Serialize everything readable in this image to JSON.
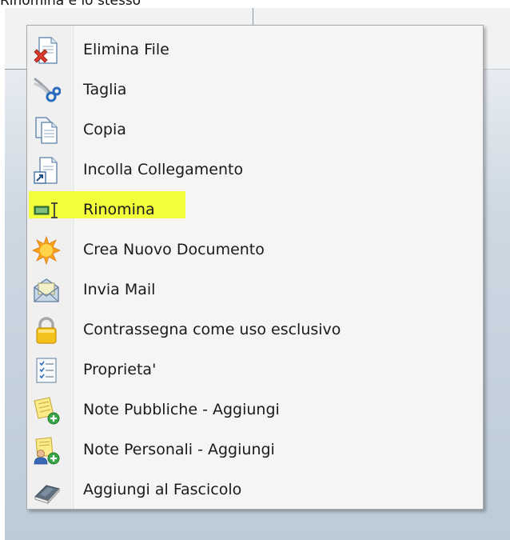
{
  "caption": "Rinomina e lo stesso",
  "colors": {
    "highlight": "#f2ff3b",
    "menu_background": "#f5f5f5",
    "menu_border": "#a8a8a8"
  },
  "menu": {
    "items": [
      {
        "label": "Elimina File",
        "icon": "delete-file-icon"
      },
      {
        "label": "Taglia",
        "icon": "scissors-icon"
      },
      {
        "label": "Copia",
        "icon": "copy-icon"
      },
      {
        "label": "Incolla Collegamento",
        "icon": "paste-link-icon"
      },
      {
        "label": "Rinomina",
        "icon": "rename-icon",
        "highlighted": true
      },
      {
        "label": "Crea Nuovo Documento",
        "icon": "new-document-star-icon"
      },
      {
        "label": "Invia Mail",
        "icon": "mail-icon"
      },
      {
        "label": "Contrassegna come uso esclusivo",
        "icon": "lock-icon"
      },
      {
        "label": "Proprieta'",
        "icon": "properties-icon"
      },
      {
        "label": "Note Pubbliche - Aggiungi",
        "icon": "public-note-add-icon"
      },
      {
        "label": "Note Personali - Aggiungi",
        "icon": "personal-note-add-icon"
      },
      {
        "label": "Aggiungi al Fascicolo",
        "icon": "folder-book-icon"
      }
    ]
  }
}
